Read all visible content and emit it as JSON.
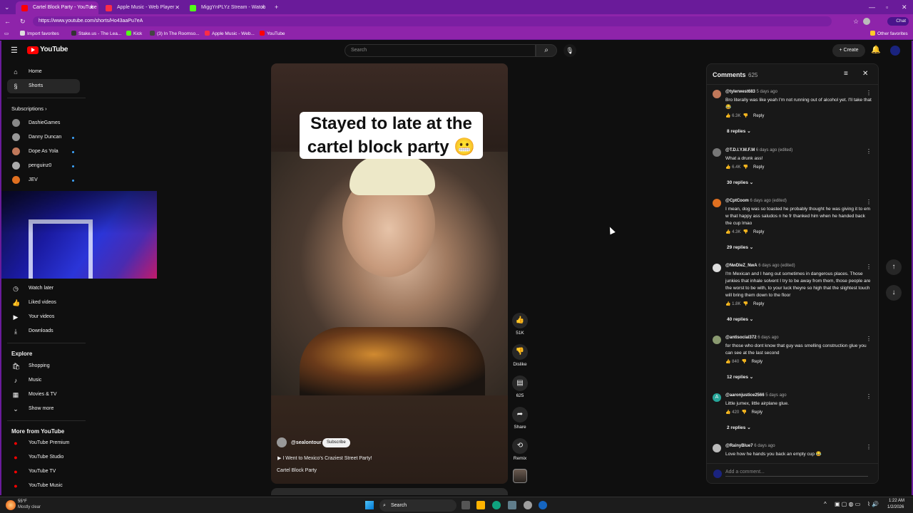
{
  "browser": {
    "tabs": [
      {
        "title": "Cartel Block Party - YouTube",
        "color": "#ff0000"
      },
      {
        "title": "Apple Music - Web Player",
        "color": "#fa2d48"
      },
      {
        "title": "MiggYnPLYz Stream - Watch",
        "color": "#53fc18"
      }
    ],
    "url": "https://www.youtube.com/shorts/Ho43aaPu7eA",
    "chat_label": "Chat",
    "bookmarks": [
      "Import favorites",
      "Stake.us - The Lea...",
      "Kick",
      "(3) In The Roomso...",
      "Apple Music - Web...",
      "YouTube"
    ],
    "other_favorites": "Other favorites"
  },
  "youtube": {
    "logo": "YouTube",
    "search_placeholder": "Search",
    "create_label": "Create",
    "nav": {
      "home": "Home",
      "shorts": "Shorts",
      "subscriptions_header": "Subscriptions",
      "subs": [
        "DashieGames",
        "Danny Duncan",
        "Dope As Yola",
        "penguinz0",
        "JEV"
      ],
      "you": [
        "Watch later",
        "Liked videos",
        "Your videos",
        "Downloads"
      ],
      "explore_header": "Explore",
      "explore": [
        "Shopping",
        "Music",
        "Movies & TV",
        "Show more"
      ],
      "more_header": "More from YouTube",
      "more": [
        "YouTube Premium",
        "YouTube Studio",
        "YouTube TV",
        "YouTube Music"
      ]
    },
    "short": {
      "caption_line1": "Stayed to late at the",
      "caption_line2": "cartel block party 😬",
      "channel": "@sealontour",
      "subscribe": "Subscribe",
      "linked_video": "I Went to Mexico's Craziest Street Party!",
      "title": "Cartel Block Party",
      "likes": "51K",
      "dislike": "Dislike",
      "comments": "625",
      "share": "Share",
      "remix": "Remix"
    },
    "comments_panel": {
      "title": "Comments",
      "count": "625",
      "add_placeholder": "Add a comment...",
      "items": [
        {
          "author": "@tylerwest683",
          "time": "5 days ago",
          "text": "Bro literally was like yeah I'm not running out of alcohol yet. I'll take that 😂",
          "likes": "6.3K",
          "reply": "Reply",
          "replies": "8 replies",
          "color": "#c0785a"
        },
        {
          "author": "@T.D.I.Y.M.F.M",
          "time": "6 days ago (edited)",
          "text": "What a drunk ass!",
          "likes": "6.4K",
          "reply": "Reply",
          "replies": "30 replies",
          "color": "#777777"
        },
        {
          "author": "@CptCoom",
          "time": "6 days ago (edited)",
          "text": "I mean, dog was so toasted he probably thought he was giving it to em w that happy ass saludos n he fr thanked him when he handed back the cup lmao",
          "likes": "4.3K",
          "reply": "Reply",
          "replies": "29 replies",
          "color": "#e07020"
        },
        {
          "author": "@NwDleZ_NwA",
          "time": "6 days ago (edited)",
          "text": "I'm Mexican and I hang out sometimes in dangerous places. Those junkies that inhale solvent I try to be away from them, those people are the worst to be with, to your luck theyre so high that the slightest touch will bring them down to the floor",
          "likes": "1.8K",
          "reply": "Reply",
          "replies": "40 replies",
          "color": "#dddddd"
        },
        {
          "author": "@antisocial372",
          "time": "6 days ago",
          "text": "for those who dont know that guy was smelling construction glue you can see at the last second",
          "likes": "840",
          "reply": "Reply",
          "replies": "12 replies",
          "color": "#8a9a70"
        },
        {
          "author": "@aaronjustice2566",
          "time": "5 days ago",
          "text": "Little jumex, little airplane glue.",
          "likes": "420",
          "reply": "Reply",
          "replies": "2 replies",
          "color": "#26a69a",
          "initial": "A"
        },
        {
          "author": "@RainyBlue7",
          "time": "6 days ago",
          "text": "Love how he hands you back an empty cup 😂",
          "likes": "",
          "reply": "",
          "replies": "",
          "color": "#bbbbbb"
        }
      ]
    }
  },
  "taskbar": {
    "weather_temp": "55°F",
    "weather_desc": "Mostly clear",
    "search": "Search",
    "time": "1:22 AM",
    "date": "1/2/2026"
  }
}
